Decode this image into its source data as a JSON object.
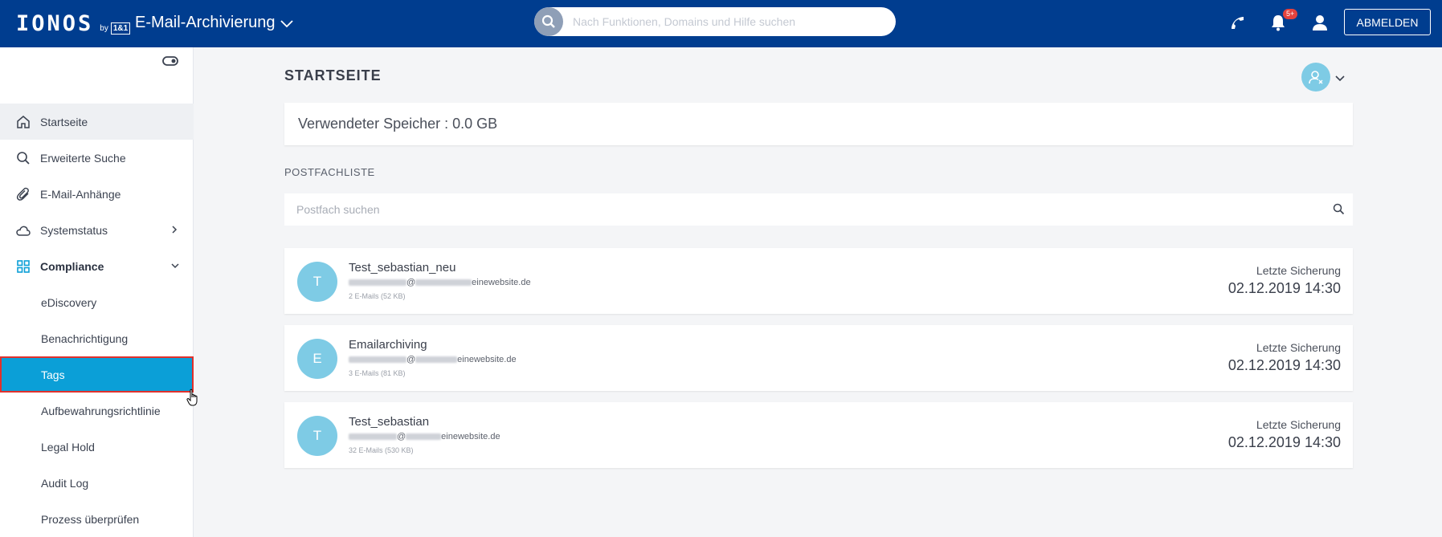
{
  "header": {
    "logo": "IONOS",
    "logo_by": "by",
    "logo_brand": "1&1",
    "app_title": "E-Mail-Archivierung",
    "search_placeholder": "Nach Funktionen, Domains und Hilfe suchen",
    "notification_badge": "5+",
    "logout_label": "ABMELDEN"
  },
  "sidebar": {
    "items": [
      {
        "label": "Startseite",
        "icon": "home-icon"
      },
      {
        "label": "Erweiterte Suche",
        "icon": "search-icon"
      },
      {
        "label": "E-Mail-Anhänge",
        "icon": "paperclip-icon"
      },
      {
        "label": "Systemstatus",
        "icon": "cloud-icon"
      },
      {
        "label": "Compliance",
        "icon": "grid-icon"
      }
    ],
    "sub_items": [
      {
        "label": "eDiscovery"
      },
      {
        "label": "Benachrichtigung"
      },
      {
        "label": "Tags"
      },
      {
        "label": "Aufbewahrungsrichtlinie"
      },
      {
        "label": "Legal Hold"
      },
      {
        "label": "Audit Log"
      },
      {
        "label": "Prozess überprüfen"
      }
    ]
  },
  "main": {
    "title": "STARTSEITE",
    "storage_text": "Verwendeter Speicher : 0.0 GB",
    "section_label": "POSTFACHLISTE",
    "mailbox_search_placeholder": "Postfach suchen",
    "mailboxes": [
      {
        "initial": "T",
        "name": "Test_sebastian_neu",
        "domain": "einewebsite.de",
        "count": "2 E-Mails (52 KB)",
        "last_label": "Letzte Sicherung",
        "last_date": "02.12.2019 14:30"
      },
      {
        "initial": "E",
        "name": "Emailarchiving",
        "domain": "einewebsite.de",
        "count": "3 E-Mails (81 KB)",
        "last_label": "Letzte Sicherung",
        "last_date": "02.12.2019 14:30"
      },
      {
        "initial": "T",
        "name": "Test_sebastian",
        "domain": "einewebsite.de",
        "count": "32 E-Mails (530 KB)",
        "last_label": "Letzte Sicherung",
        "last_date": "02.12.2019 14:30"
      }
    ]
  },
  "colors": {
    "header_bg": "#003d8f",
    "selected_bg": "#0b9fd7",
    "avatar_bg": "#7ecbe5",
    "highlight_border": "#e0312c"
  }
}
